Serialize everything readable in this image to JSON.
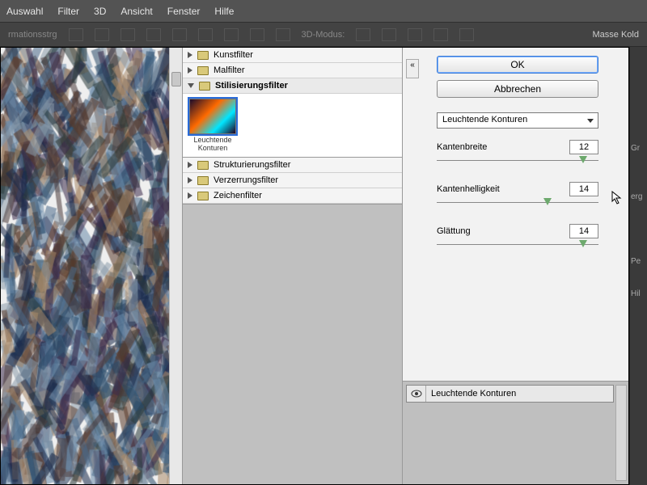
{
  "menubar": {
    "items": [
      "Auswahl",
      "Filter",
      "3D",
      "Ansicht",
      "Fenster",
      "Hilfe"
    ]
  },
  "optbar": {
    "label": "rmationsstrg",
    "mode": "3D-Modus:"
  },
  "right_labels": {
    "a": "Masse Kold",
    "b": "Gr",
    "c": "Pe",
    "d": "Hil",
    "e": "erg"
  },
  "tree": {
    "items": [
      {
        "label": "Kunstfilter",
        "open": false
      },
      {
        "label": "Malfilter",
        "open": false
      },
      {
        "label": "Stilisierungsfilter",
        "open": true
      },
      {
        "label": "Strukturierungsfilter",
        "open": false
      },
      {
        "label": "Verzerrungsfilter",
        "open": false
      },
      {
        "label": "Zeichenfilter",
        "open": false
      }
    ],
    "thumb": {
      "label": "Leuchtende Konturen"
    }
  },
  "controls": {
    "ok": "OK",
    "cancel": "Abbrechen",
    "filter_select": "Leuchtende Konturen",
    "params": [
      {
        "label": "Kantenbreite",
        "value": "12",
        "pos": 88
      },
      {
        "label": "Kantenhelligkeit",
        "value": "14",
        "pos": 66
      },
      {
        "label": "Glättung",
        "value": "14",
        "pos": 88
      }
    ]
  },
  "fx": {
    "active": "Leuchtende Konturen"
  }
}
